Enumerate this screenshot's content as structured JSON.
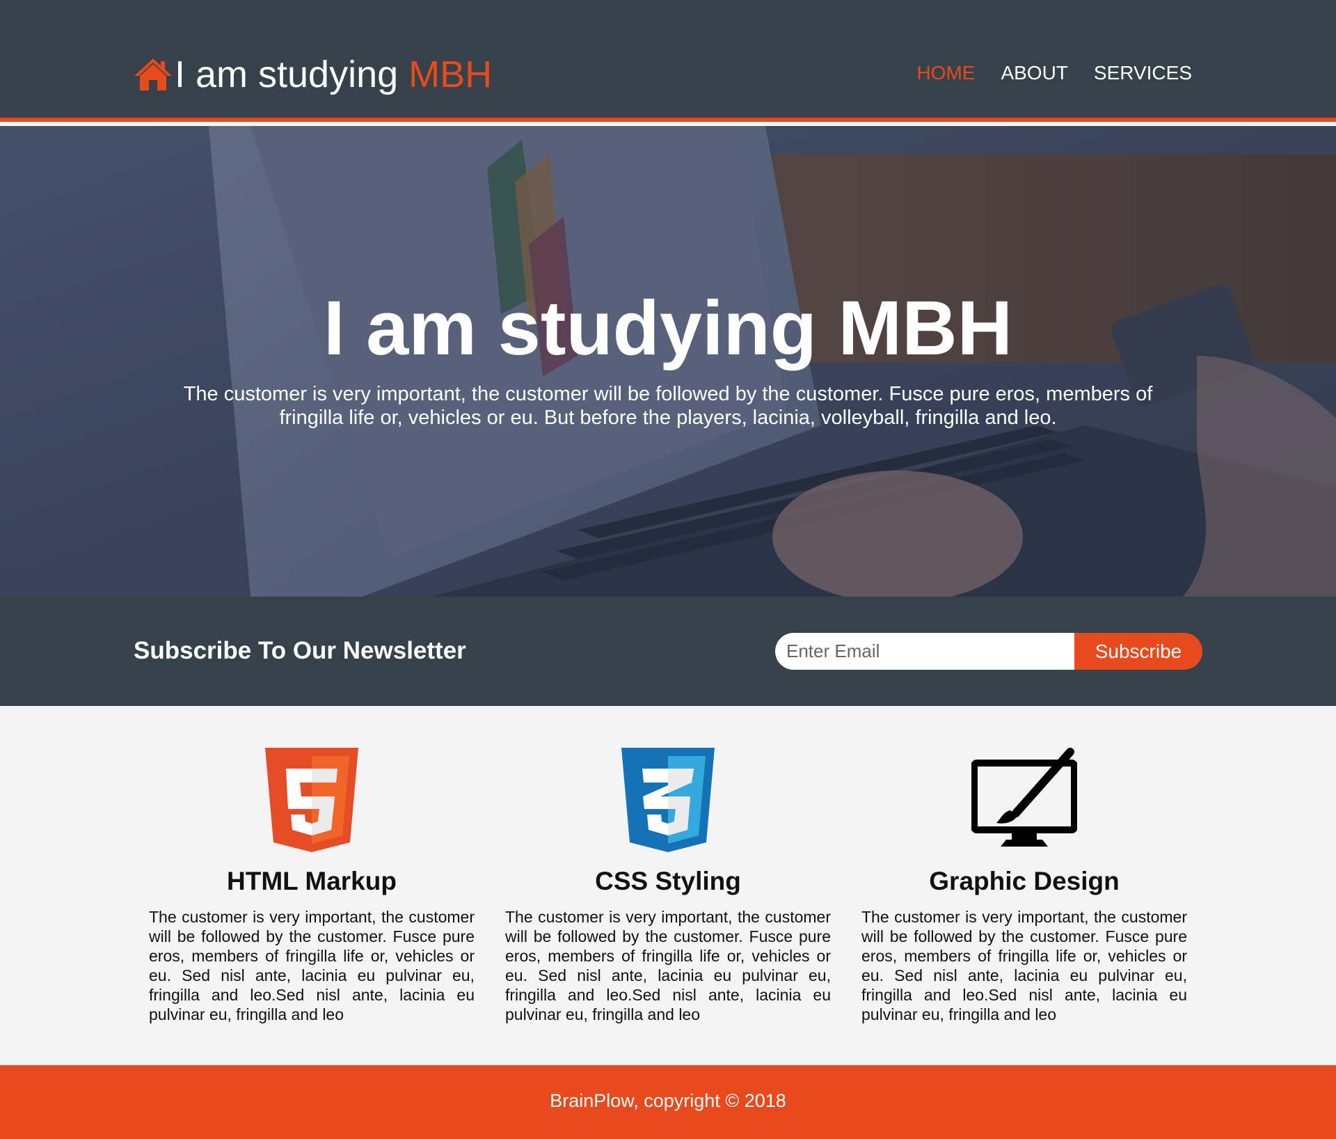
{
  "header": {
    "brand_main": "I am studying ",
    "brand_accent": "MBH",
    "nav": [
      {
        "label": "HOME",
        "active": true
      },
      {
        "label": "ABOUT",
        "active": false
      },
      {
        "label": "SERVICES",
        "active": false
      }
    ],
    "brand_icon": "home-icon"
  },
  "hero": {
    "title": "I am studying MBH",
    "text": "The customer is very important, the customer will be followed by the customer. Fusce pure eros, members of fringilla life or, vehicles or eu. But before the players, lacinia, volleyball, fringilla and leo.",
    "background": "laptop-typing-photo"
  },
  "newsletter": {
    "title": "Subscribe To Our Newsletter",
    "email_placeholder": "Enter Email",
    "email_value": "",
    "button_label": "Subscribe"
  },
  "boxes": [
    {
      "icon": "html5-icon",
      "title": "HTML Markup",
      "text": "The customer is very important, the customer will be followed by the customer. Fusce pure eros, members of fringilla life or, vehicles or eu. Sed nisl ante, lacinia eu pulvinar eu, fringilla and leo.Sed nisl ante, lacinia eu pulvinar eu, fringilla and leo"
    },
    {
      "icon": "css3-icon",
      "title": "CSS Styling",
      "text": "The customer is very important, the customer will be followed by the customer. Fusce pure eros, members of fringilla life or, vehicles or eu. Sed nisl ante, lacinia eu pulvinar eu, fringilla and leo.Sed nisl ante, lacinia eu pulvinar eu, fringilla and leo"
    },
    {
      "icon": "graphic-design-icon",
      "title": "Graphic Design",
      "text": "The customer is very important, the customer will be followed by the customer. Fusce pure eros, members of fringilla life or, vehicles or eu. Sed nisl ante, lacinia eu pulvinar eu, fringilla and leo.Sed nisl ante, lacinia eu pulvinar eu, fringilla and leo"
    }
  ],
  "footer": {
    "text": "BrainPlow, copyright © 2018"
  },
  "colors": {
    "dark": "#35424a",
    "accent": "#e8491d",
    "light_bg": "#f4f4f4",
    "white": "#ffffff"
  }
}
